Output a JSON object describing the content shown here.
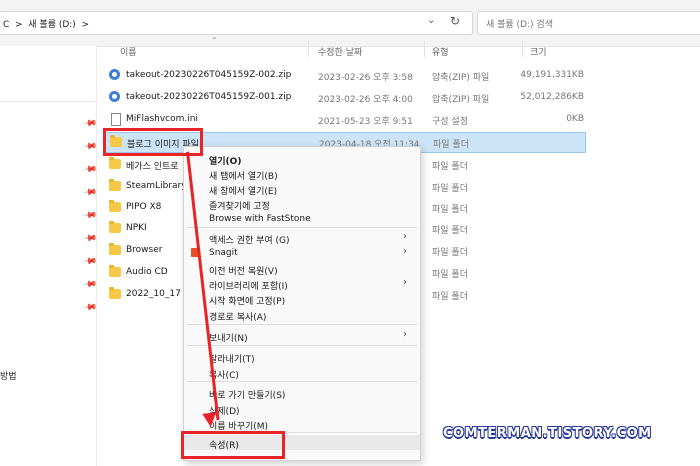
{
  "address": {
    "breadcrumb": "C  >  새 볼륨 (D:)  >",
    "chevron_icon": "chevron-down-icon",
    "refresh_icon": "refresh-icon"
  },
  "search": {
    "placeholder": "새 볼륨 (D:) 검색"
  },
  "nav": {
    "partial_label": "방법",
    "pin_icon": "pin-icon"
  },
  "columns": {
    "name": "이름",
    "date": "수정한 날짜",
    "type": "유형",
    "size": "크기"
  },
  "files": [
    {
      "name": "takeout-20230226T045159Z-002.zip",
      "date": "2023-02-26 오후 3:58",
      "type": "압축(ZIP) 파일",
      "size": "49,191,331KB",
      "icon": "zip-icon"
    },
    {
      "name": "takeout-20230226T045159Z-001.zip",
      "date": "2023-02-26 오후 4:00",
      "type": "압축(ZIP) 파일",
      "size": "52,012,286KB",
      "icon": "zip-icon"
    },
    {
      "name": "MiFlashvcom.ini",
      "date": "2021-05-23 오후 9:51",
      "type": "구성 설정",
      "size": "0KB",
      "icon": "ini-file-icon"
    },
    {
      "name": "블로그 이미지 파일",
      "date": "2023-04-18 오전 11:34",
      "type": "파일 폴더",
      "size": "",
      "icon": "folder-icon",
      "selected": true
    },
    {
      "name": "베가스 인트로",
      "date": "",
      "type": "파일 폴더",
      "size": "",
      "icon": "folder-icon"
    },
    {
      "name": "SteamLibrary",
      "date": "",
      "type": "파일 폴더",
      "size": "",
      "icon": "folder-icon"
    },
    {
      "name": "PIPO X8",
      "date": "",
      "type": "파일 폴더",
      "size": "",
      "icon": "folder-icon"
    },
    {
      "name": "NPKI",
      "date": "",
      "type": "파일 폴더",
      "size": "",
      "icon": "folder-icon"
    },
    {
      "name": "Browser",
      "date": "",
      "type": "파일 폴더",
      "size": "",
      "icon": "folder-icon"
    },
    {
      "name": "Audio CD",
      "date": "",
      "type": "파일 폴더",
      "size": "",
      "icon": "folder-icon"
    },
    {
      "name": "2022_10_17",
      "date": "",
      "type": "파일 폴더",
      "size": "",
      "icon": "folder-icon"
    }
  ],
  "context_menu": {
    "items": [
      {
        "label": "열기(O)",
        "bold": true
      },
      {
        "label": "새 탭에서 열기(B)"
      },
      {
        "label": "새 창에서 열기(E)"
      },
      {
        "label": "즐겨찾기에 고정"
      },
      {
        "label": "Browse with FastStone"
      },
      {
        "label": "액세스 권한 부여 (G)",
        "submenu": true
      },
      {
        "label": "Snagit",
        "submenu": true,
        "icon": "snagit-icon"
      },
      {
        "label": "이전 버전 복원(V)"
      },
      {
        "label": "라이브러리에 포함(I)",
        "submenu": true
      },
      {
        "label": "시작 화면에 고정(P)"
      },
      {
        "label": "경로로 복사(A)"
      },
      {
        "label": "보내기(N)",
        "submenu": true
      },
      {
        "label": "잘라내기(T)"
      },
      {
        "label": "복사(C)"
      },
      {
        "label": "바로 가기 만들기(S)"
      },
      {
        "label": "삭제(D)"
      },
      {
        "label": "이름 바꾸기(M)"
      },
      {
        "label": "속성(R)",
        "highlighted": true
      }
    ],
    "submenu_icon": "chevron-right-icon"
  },
  "watermark": "COMTERMAN.TISTORY.COM",
  "colors": {
    "annotation_red": "#e8242a",
    "selection": "#cce4f7",
    "folder": "#f6c845"
  }
}
